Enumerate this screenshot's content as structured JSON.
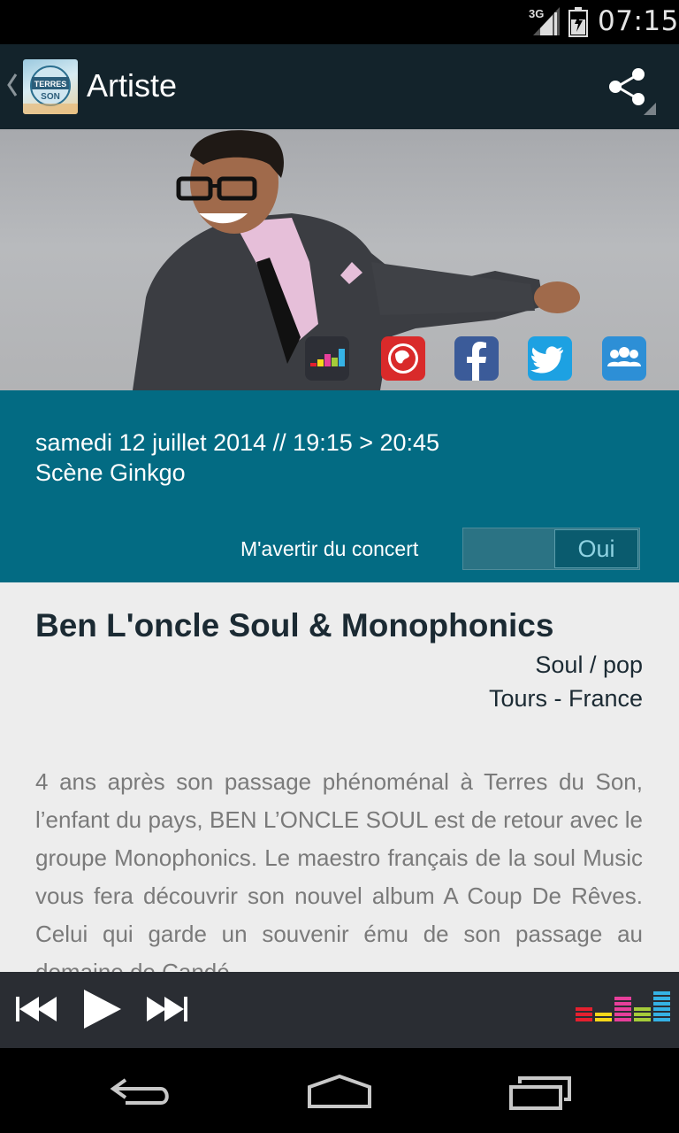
{
  "status_bar": {
    "network": "3G",
    "time": "07:15"
  },
  "action_bar": {
    "title": "Artiste",
    "logo_text": "TERRES DU SON"
  },
  "hero": {
    "social_icons": [
      "deezer-icon",
      "website-icon",
      "facebook-icon",
      "twitter-icon",
      "community-icon"
    ]
  },
  "concert": {
    "datetime": "samedi 12 juillet 2014 // 19:15 > 20:45",
    "stage": "Scène Ginkgo",
    "alert_label": "M'avertir du concert",
    "alert_toggle": "Oui"
  },
  "artist": {
    "name": "Ben L'oncle Soul & Monophonics",
    "genre": "Soul / pop",
    "origin": "Tours - France",
    "bio": "4 ans après son passage phénoménal à Terres du Son, l’enfant du pays, BEN L’ONCLE SOUL est de retour avec le groupe Monophonics. Le maestro français de la soul Music vous fera découvrir son nouvel album A Coup De Rêves. Celui qui garde un souvenir ému de son passage au domaine de Candé"
  },
  "colors": {
    "action_bar": "#13232b",
    "info_band": "#036b83",
    "content_bg": "#ededed",
    "player_bg": "#2a2d33"
  }
}
